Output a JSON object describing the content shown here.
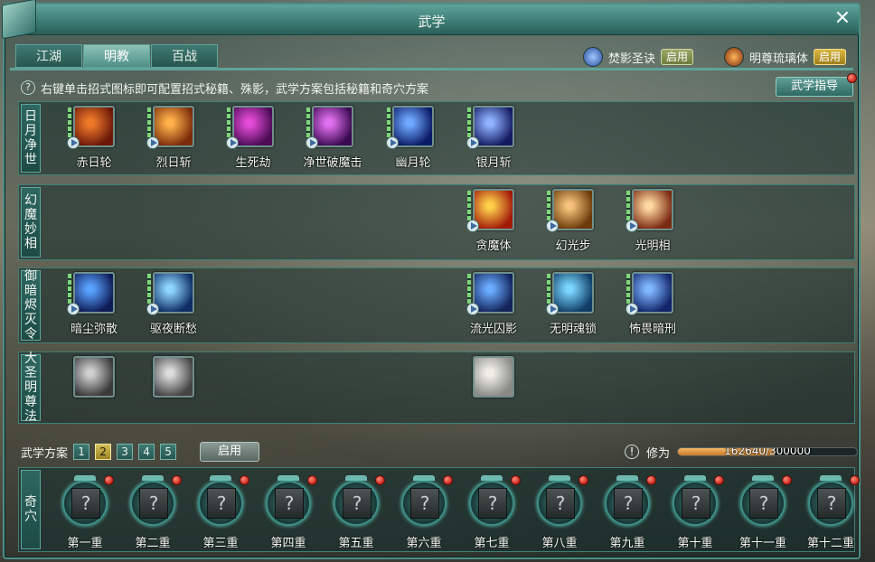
{
  "window": {
    "title": "武学"
  },
  "tabs": [
    {
      "label": "江湖",
      "active": false
    },
    {
      "label": "明教",
      "active": true
    },
    {
      "label": "百战",
      "active": false
    }
  ],
  "toggles": [
    {
      "label": "焚影圣诀",
      "state": "启用",
      "icon": "blade-icon"
    },
    {
      "label": "明尊琉璃体",
      "state": "启用",
      "icon": "flame-shield-icon"
    }
  ],
  "hint": {
    "text": "右键单击招式图标即可配置招式秘籍、殊影，武学方案包括秘籍和奇穴方案"
  },
  "guide_button": "武学指导",
  "schools": [
    {
      "name": [
        "日",
        "月",
        "净",
        "世"
      ],
      "skills": [
        {
          "name": "赤日轮",
          "colors": [
            "#f07a2a",
            "#6a1708"
          ]
        },
        {
          "name": "烈日斩",
          "colors": [
            "#ffb24a",
            "#7a2c0a"
          ]
        },
        {
          "name": "生死劫",
          "colors": [
            "#e34bd8",
            "#4a0b53"
          ]
        },
        {
          "name": "净世破魔击",
          "colors": [
            "#e070f0",
            "#3b0950"
          ]
        },
        {
          "name": "幽月轮",
          "colors": [
            "#6fa9ff",
            "#0b1a66"
          ]
        },
        {
          "name": "银月斩",
          "colors": [
            "#8fb2ff",
            "#141a60"
          ]
        }
      ]
    },
    {
      "name": [
        "幻",
        "魔",
        "妙",
        "相"
      ],
      "skills": [
        {
          "name": "贪魔体",
          "colors": [
            "#ffcf4a",
            "#a11a0a"
          ]
        },
        {
          "name": "幻光步",
          "colors": [
            "#f4c27a",
            "#6b3a0a"
          ]
        },
        {
          "name": "光明相",
          "colors": [
            "#ffd8a0",
            "#7a2a12"
          ]
        }
      ]
    },
    {
      "name": [
        "御",
        "暗",
        "烬",
        "灭",
        "令"
      ],
      "skills": [
        {
          "name": "暗尘弥散",
          "colors": [
            "#5aa2ff",
            "#0e1b55"
          ]
        },
        {
          "name": "驱夜断愁",
          "colors": [
            "#8fd6ff",
            "#0e2d66"
          ]
        },
        {
          "name": "流光囚影",
          "colors": [
            "#6aaaff",
            "#12245a"
          ]
        },
        {
          "name": "无明魂锁",
          "colors": [
            "#7ad6ff",
            "#0f3d66"
          ]
        },
        {
          "name": "怖畏暗刑",
          "colors": [
            "#7fb8ff",
            "#12246a"
          ]
        }
      ]
    },
    {
      "name": [
        "大",
        "圣",
        "明",
        "尊",
        "法"
      ],
      "skills": [
        {
          "name": "",
          "colors": [
            "#cfcfcf",
            "#3a3a3a"
          ]
        },
        {
          "name": "",
          "colors": [
            "#dcdcdc",
            "#444444"
          ]
        },
        {
          "name": "",
          "colors": [
            "#f0efe8",
            "#8a8a86"
          ]
        }
      ]
    }
  ],
  "plan": {
    "label": "武学方案",
    "options": [
      "1",
      "2",
      "3",
      "4",
      "5"
    ],
    "selected": 2,
    "enable_label": "启用"
  },
  "cultivation": {
    "label": "修为",
    "current": 162640,
    "max": 300000,
    "text": "162640/300000"
  },
  "qixue": {
    "label": [
      "奇",
      "穴"
    ],
    "slots": [
      "第一重",
      "第二重",
      "第三重",
      "第四重",
      "第五重",
      "第六重",
      "第七重",
      "第八重",
      "第九重",
      "第十重",
      "第十一重",
      "第十二重"
    ],
    "placeholder": "?"
  },
  "colors": {
    "accent": "#4d8e86",
    "active_tab": "#8cc3b8",
    "enable_gold": "#d9b642",
    "progress": "#e0953a",
    "notify_red": "#c8251a"
  }
}
